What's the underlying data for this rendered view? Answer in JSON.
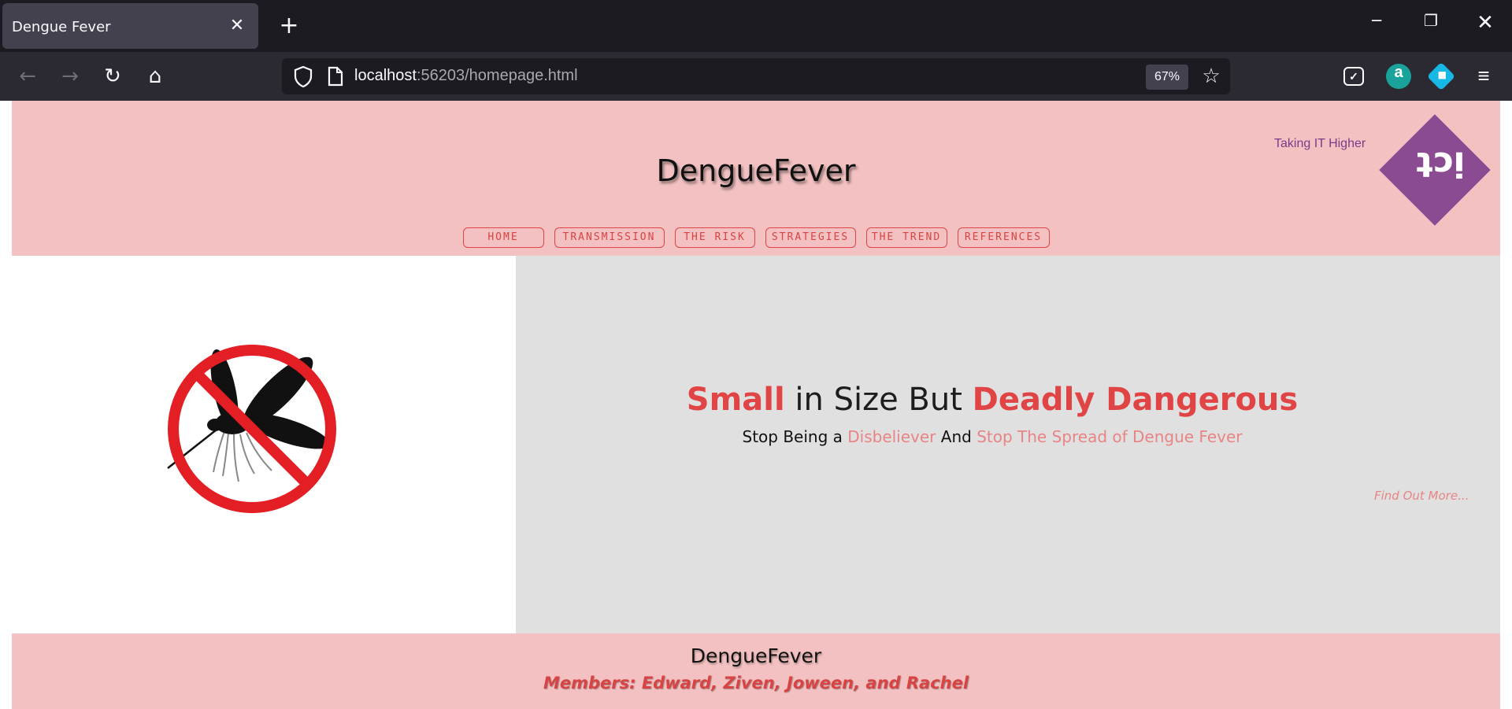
{
  "browser": {
    "tab_title": "Dengue Fever",
    "tab_close_icon": "close-icon",
    "new_tab_icon": "plus-icon",
    "url_host": "localhost",
    "url_path": ":56203/homepage.html",
    "zoom": "67%",
    "window_controls": [
      "minimize-icon",
      "restore-icon",
      "close-icon"
    ],
    "extensions": [
      "pocket-icon",
      "amazon-icon",
      "extension-icon",
      "menu-icon"
    ]
  },
  "header": {
    "title": "DengueFever",
    "tagline": "Taking IT Higher",
    "logo_text": "ict",
    "nav": [
      "HOME",
      "TRANSMISSION",
      "THE RISK",
      "STRATEGIES",
      "THE TREND",
      "REFERENCES"
    ]
  },
  "hero": {
    "headline_1": "Small",
    "headline_2": " in Size But ",
    "headline_3": "Deadly Dangerous",
    "sub_1": "Stop Being a ",
    "sub_2": "Disbeliever",
    "sub_3": " And ",
    "sub_4": "Stop The Spread of Dengue Fever",
    "find_more": "Find Out More...",
    "image": "no-mosquito-icon"
  },
  "footer": {
    "title": "DengueFever",
    "members": "Members: Edward, Ziven, Joween, and Rachel"
  },
  "colors": {
    "header_bg": "#f3c1c1",
    "accent_red": "#e04444",
    "accent_pink": "#e98484",
    "logo_purple": "#8a4b93",
    "hero_bg": "#e0e0e0"
  }
}
